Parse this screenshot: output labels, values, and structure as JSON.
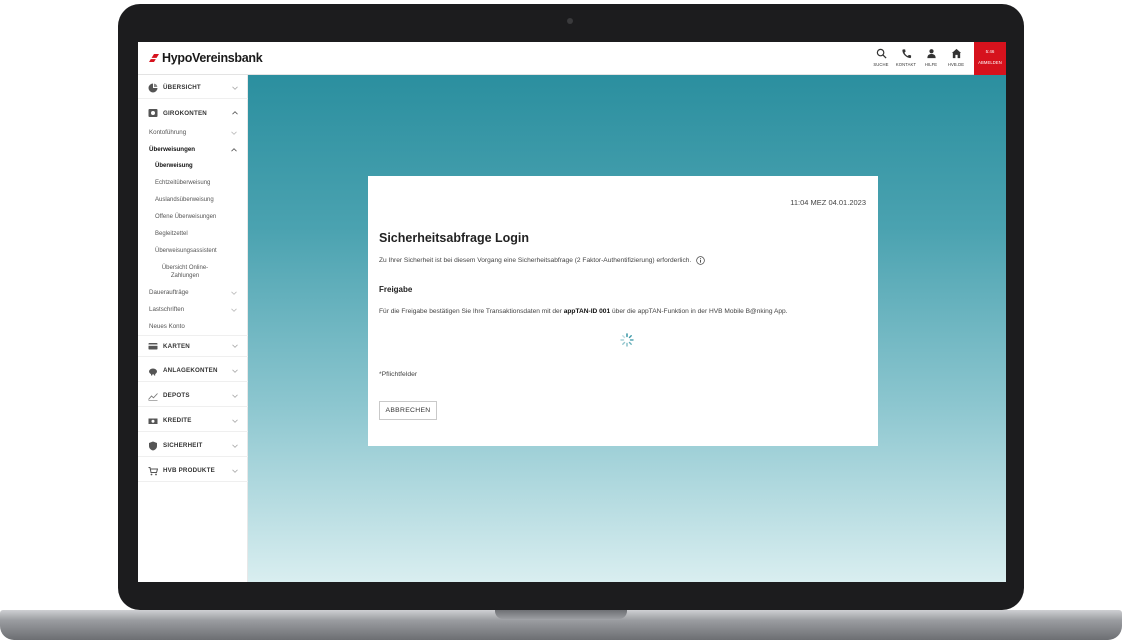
{
  "header": {
    "brand": "HypoVereinsbank",
    "nav": [
      {
        "label": "SUCHE",
        "icon": "search-icon"
      },
      {
        "label": "KONTAKT",
        "icon": "phone-icon"
      },
      {
        "label": "HILFE",
        "icon": "person-icon"
      },
      {
        "label": "HVB.DE",
        "icon": "home-icon"
      }
    ],
    "logout": {
      "time": "5:46",
      "label": "ABMELDEN"
    },
    "colors": {
      "brand_red": "#d6121d"
    }
  },
  "sidebar": {
    "overview": "ÜBERSICHT",
    "girokonten": {
      "label": "GIROKONTEN",
      "items": {
        "kontofuehrung": "Kontoführung",
        "ueberweisungen": "Überweisungen",
        "ueberweisungen_sub": [
          "Überweisung",
          "Echtzeitüberweisung",
          "Auslandsüberweisung",
          "Offene Überweisungen",
          "Begleitzettel",
          "Überweisungsassistent",
          "Übersicht Online-",
          "Zahlungen"
        ],
        "dauerauftraege": "Daueraufträge",
        "lastschriften": "Lastschriften",
        "neues_konto": "Neues Konto"
      }
    },
    "sections": [
      "KARTEN",
      "ANLAGEKONTEN",
      "DEPOTS",
      "KREDITE",
      "SICHERHEIT",
      "HVB PRODUKTE"
    ]
  },
  "dialog": {
    "timestamp": "11:04 MEZ 04.01.2023",
    "title": "Sicherheitsabfrage Login",
    "intro": "Zu Ihrer Sicherheit ist bei diesem Vorgang eine Sicherheitsabfrage (2 Faktor-Authentifizierung) erforderlich.",
    "section_title": "Freigabe",
    "instruction_pre": "Für die Freigabe bestätigen Sie Ihre Transaktionsdaten mit der ",
    "instruction_bold": "appTAN-ID 001",
    "instruction_post": " über die appTAN-Funktion in der HVB Mobile B@nking App.",
    "required_note": "*Pflichtfelder",
    "cancel_label": "ABBRECHEN"
  }
}
